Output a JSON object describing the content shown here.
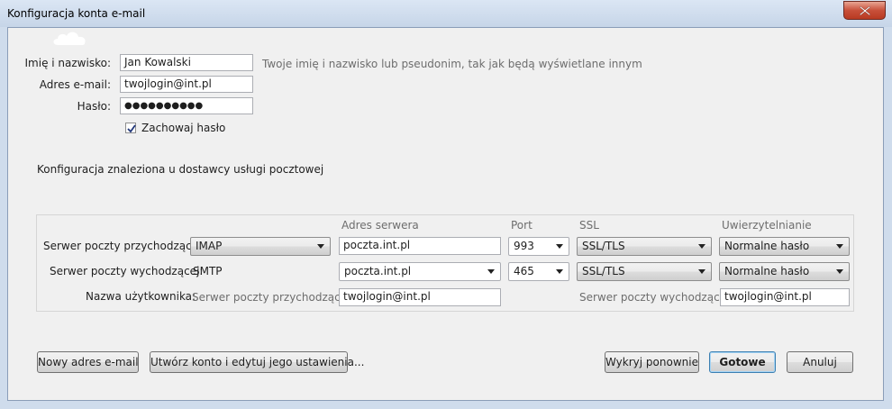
{
  "window": {
    "title": "Konfiguracja konta e-mail"
  },
  "form": {
    "name_label": "Imię i nazwisko:",
    "name_value": "Jan Kowalski",
    "name_hint": "Twoje imię i nazwisko lub pseudonim, tak jak będą wyświetlane innym",
    "email_label": "Adres e-mail:",
    "email_value": "twojlogin@int.pl",
    "password_label": "Hasło:",
    "password_value": "●●●●●●●●●●",
    "remember_label": "Zachowaj hasło",
    "remember_checked": true,
    "status_text": "Konfiguracja znaleziona u dostawcy usługi pocztowej"
  },
  "servers": {
    "headers": {
      "address": "Adres serwera",
      "port": "Port",
      "ssl": "SSL",
      "auth": "Uwierzytelnianie"
    },
    "incoming": {
      "label": "Serwer poczty przychodzącej:",
      "protocol": "IMAP",
      "address": "poczta.int.pl",
      "port": "993",
      "ssl": "SSL/TLS",
      "auth": "Normalne hasło"
    },
    "outgoing": {
      "label": "Serwer poczty wychodzącej:",
      "protocol": "SMTP",
      "address": "poczta.int.pl",
      "port": "465",
      "ssl": "SSL/TLS",
      "auth": "Normalne hasło"
    },
    "username": {
      "label": "Nazwa użytkownika:",
      "incoming_label": "Serwer poczty przychodzącej:",
      "incoming_value": "twojlogin@int.pl",
      "outgoing_label": "Serwer poczty wychodzącej:",
      "outgoing_value": "twojlogin@int.pl"
    }
  },
  "buttons": {
    "new_address": "Nowy adres e-mail",
    "create_edit": "Utwórz konto i edytuj jego ustawienia...",
    "retest": "Wykryj ponownie",
    "done": "Gotowe",
    "cancel": "Anuluj"
  },
  "colors": {
    "accent": "#3c7fb1",
    "close_button": "#c8503a"
  }
}
